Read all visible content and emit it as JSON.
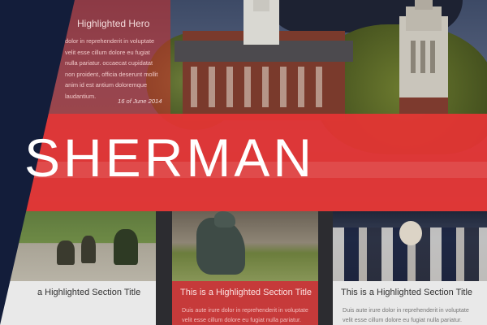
{
  "hero": {
    "title": "Highlighted Hero",
    "body": "dolor in reprehenderit in voluptate velit esse cillum dolore eu fugiat nulla pariatur. occaecat cupidatat non proident, officia deserunt mollit anim id est antium doloremque laudantium.",
    "date": "16 of June 2014"
  },
  "banner": {
    "title": "SHERMAN"
  },
  "sections": [
    {
      "title": "a Highlighted Section Title",
      "body": ""
    },
    {
      "title": "This is a Highlighted Section Title",
      "body": "Duis aute irure dolor in reprehenderit in voluptate velit esse cillum dolore eu fugiat nulla pariatur."
    },
    {
      "title": "This is a Highlighted Section Title",
      "body": "Duis aute irure dolor in reprehenderit in voluptate velit esse cillum dolore eu fugiat nulla pariatur."
    }
  ],
  "colors": {
    "navy": "#131d3a",
    "banner_red": "#e63434",
    "card_red": "#c63a3a",
    "card_gray": "#e9e9e9"
  }
}
